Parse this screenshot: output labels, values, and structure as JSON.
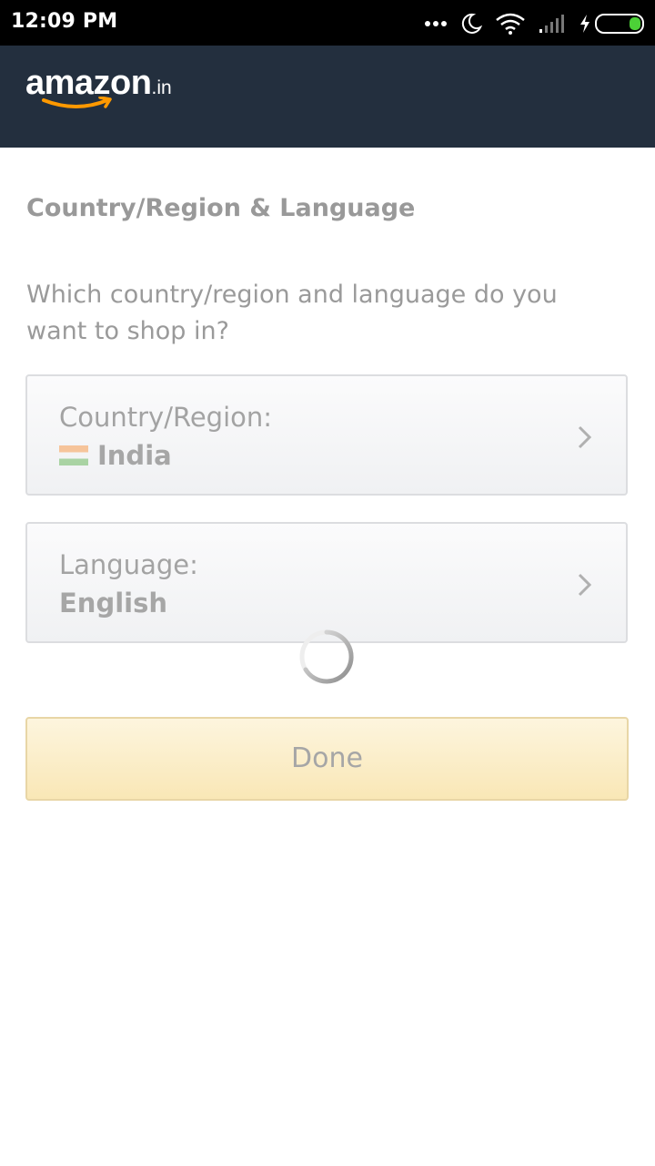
{
  "status_bar": {
    "time": "12:09 PM",
    "icons": [
      "more-dots-icon",
      "moon-icon",
      "wifi-icon",
      "signal-icon",
      "charging-icon",
      "battery-icon"
    ]
  },
  "header": {
    "logo": "amazon",
    "logo_suffix": ".in"
  },
  "page": {
    "title": "Country/Region & Language",
    "prompt": "Which country/region and language do you want to shop in?"
  },
  "country": {
    "label": "Country/Region:",
    "value": "India",
    "flag_icon": "india-flag-icon"
  },
  "language": {
    "label": "Language:",
    "value": "English"
  },
  "done_button": {
    "label": "Done"
  },
  "colors": {
    "header_bg": "#232f3e",
    "smile_orange": "#ff9900",
    "done_bg": "#fbeecb",
    "text_gray": "#a3a3a3"
  }
}
